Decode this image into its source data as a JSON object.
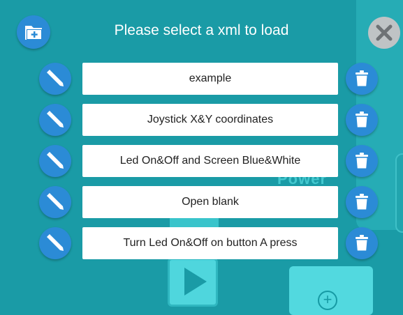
{
  "dialog": {
    "title": "Please select a xml to load",
    "icons": {
      "new": "folder-plus-icon",
      "close": "close-icon",
      "edit": "pencil-icon",
      "delete": "trash-icon"
    }
  },
  "files": [
    {
      "label": "example"
    },
    {
      "label": "Joystick X&Y coordinates"
    },
    {
      "label": "Led On&Off and Screen Blue&White"
    },
    {
      "label": "Open blank"
    },
    {
      "label": "Turn Led On&Off on button A press"
    }
  ],
  "background": {
    "power_label": "Power"
  },
  "colors": {
    "backdrop": "#1a9ba6",
    "button_blue": "#2b8bd6",
    "close_grey": "#bfc3c5"
  }
}
